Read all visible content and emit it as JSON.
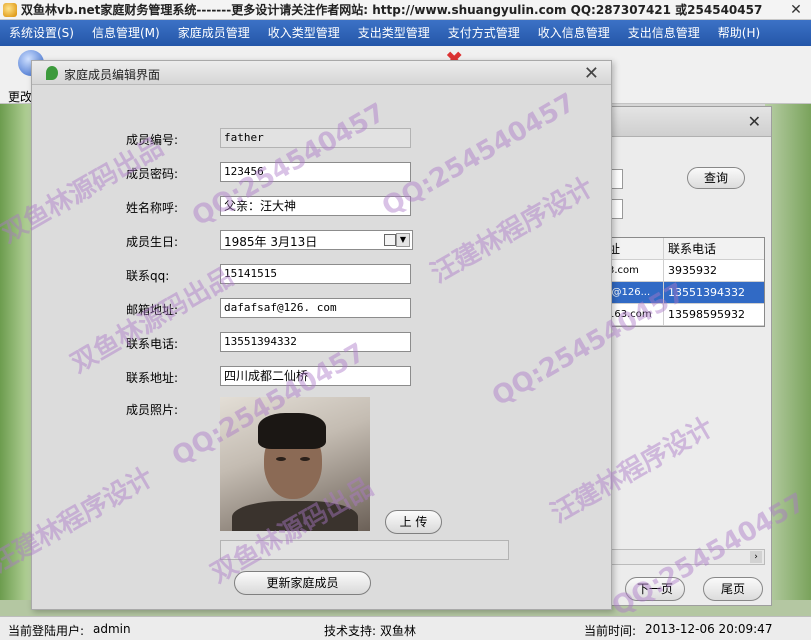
{
  "window": {
    "title": "双鱼林vb.net家庭财务管理系统-------更多设计请关注作者网站:   http://www.shuangyulin.com   QQ:287307421 或254540457",
    "close": "✕"
  },
  "menu": [
    "系统设置(S)",
    "信息管理(M)",
    "家庭成员管理",
    "收入类型管理",
    "支出类型管理",
    "支付方式管理",
    "收入信息管理",
    "支出信息管理",
    "帮助(H)"
  ],
  "toolbar": {
    "label": "更改"
  },
  "list_window": {
    "close": "✕",
    "query_button": "查询",
    "columns": [
      "址",
      "联系电话"
    ],
    "rows": [
      {
        "c1": "3.com",
        "c2": "3935932",
        "selected": false
      },
      {
        "c1": "f@126...",
        "c2": "13551394332",
        "selected": true
      },
      {
        "c1": "163.com",
        "c2": "13598595932",
        "selected": false
      }
    ],
    "scroll_arrow": "›",
    "prev_label": "下一页",
    "last_label": "尾页"
  },
  "dialog": {
    "title": "家庭成员编辑界面",
    "close": "✕",
    "labels": {
      "member_id": "成员编号:",
      "password": "成员密码:",
      "name": "姓名称呼:",
      "birthday": "成员生日:",
      "qq": "联系qq:",
      "email": "邮箱地址:",
      "phone": "联系电话:",
      "address": "联系地址:",
      "photo": "成员照片:"
    },
    "values": {
      "member_id": "father",
      "password": "123456",
      "name": "父亲：汪大神",
      "birthday": "1985年  3月13日",
      "qq": "15141515",
      "email": "dafafsaf@126. com",
      "phone": "13551394332",
      "address": "四川成都二仙桥"
    },
    "upload_button": "上 传",
    "submit_button": "更新家庭成员"
  },
  "watermarks": [
    "双鱼林源码出品",
    "QQ:254540457",
    "汪建林程序设计"
  ],
  "status": {
    "user_label": "当前登陆用户:",
    "user": "admin",
    "support_label": "技术支持:",
    "support": "双鱼林",
    "time_label": "当前时间:",
    "time": "2013-12-06 20:09:47"
  }
}
